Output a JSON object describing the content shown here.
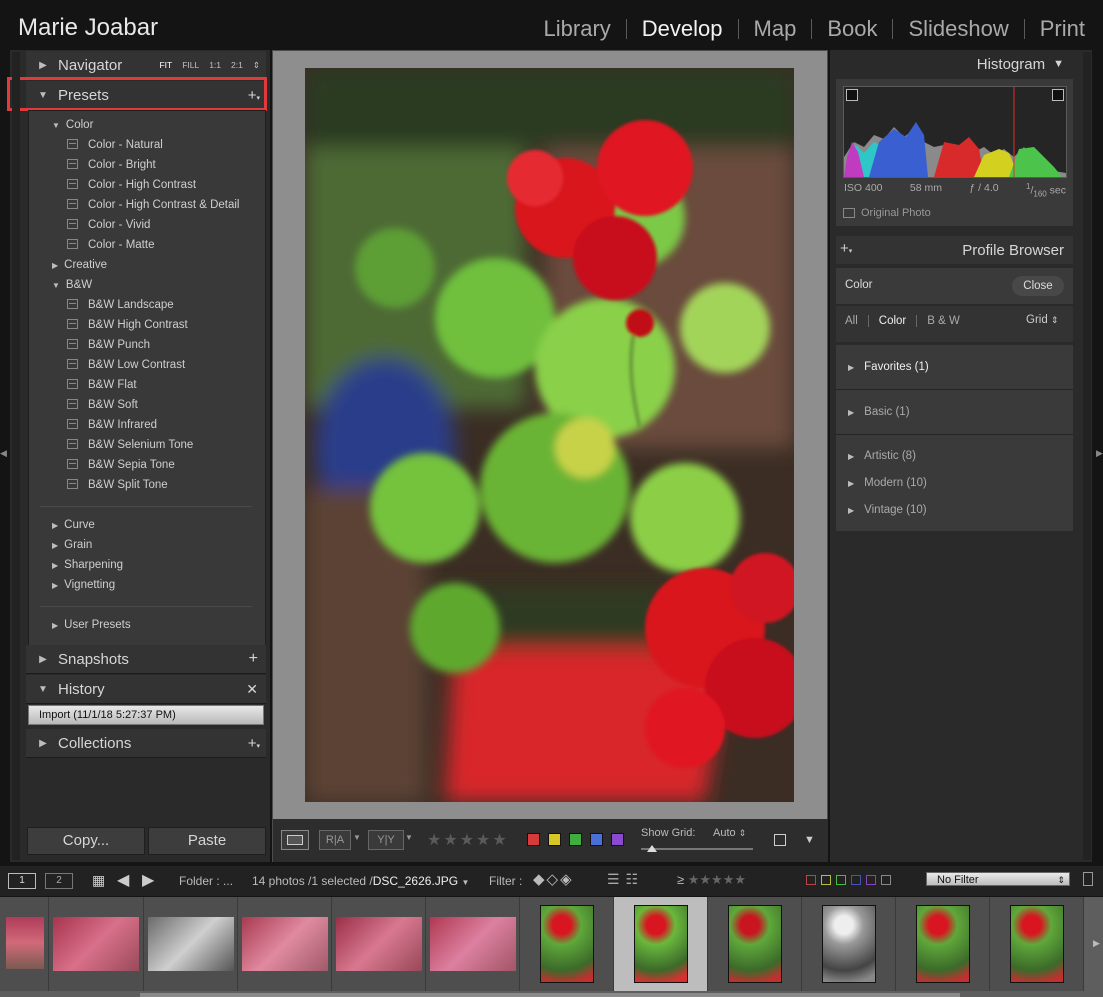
{
  "identity": "Marie Joabar",
  "modules": [
    "Library",
    "Develop",
    "Map",
    "Book",
    "Slideshow",
    "Print"
  ],
  "active_module": "Develop",
  "left": {
    "navigator": {
      "label": "Navigator",
      "zoom_options": [
        "FIT",
        "FILL",
        "1:1",
        "2:1"
      ]
    },
    "presets": {
      "label": "Presets",
      "color_folder": "Color",
      "color_items": [
        "Color - Natural",
        "Color - Bright",
        "Color - High Contrast",
        "Color - High Contrast & Detail",
        "Color - Vivid",
        "Color - Matte"
      ],
      "creative_folder": "Creative",
      "bw_folder": "B&W",
      "bw_items": [
        "B&W Landscape",
        "B&W High Contrast",
        "B&W Punch",
        "B&W Low Contrast",
        "B&W Flat",
        "B&W Soft",
        "B&W Infrared",
        "B&W Selenium Tone",
        "B&W Sepia Tone",
        "B&W Split Tone"
      ],
      "other_folders": [
        "Curve",
        "Grain",
        "Sharpening",
        "Vignetting"
      ],
      "user_folder": "User Presets"
    },
    "snapshots": {
      "label": "Snapshots"
    },
    "history": {
      "label": "History",
      "entry": "Import (11/1/18 5:27:37 PM)"
    },
    "collections": {
      "label": "Collections"
    },
    "copy_label": "Copy...",
    "paste_label": "Paste"
  },
  "right": {
    "histogram": {
      "label": "Histogram",
      "iso": "ISO 400",
      "focal": "58 mm",
      "aperture": "ƒ / 4.0",
      "shutter_num": "1",
      "shutter_den": "160",
      "shutter_unit": "sec",
      "original_photo": "Original Photo"
    },
    "profile_browser": {
      "label": "Profile Browser",
      "current": "Color",
      "close_label": "Close",
      "filters": [
        "All",
        "Color",
        "B & W"
      ],
      "active_filter": "Color",
      "view": "Grid",
      "groups": [
        {
          "label": "Favorites (1)"
        },
        {
          "label": "Basic (1)"
        },
        {
          "label": "Artistic (8)"
        },
        {
          "label": "Modern (10)"
        },
        {
          "label": "Vintage (10)"
        }
      ]
    }
  },
  "toolbar": {
    "show_grid_label": "Show Grid:",
    "show_grid_value": "Auto",
    "ra_label": "R|A",
    "yy_label": "Y|Y",
    "swatches": [
      "#d83a3a",
      "#d6c626",
      "#3fae3f",
      "#4a6fd8",
      "#8a4ad0"
    ]
  },
  "filmbar": {
    "view1": "1",
    "view2": "2",
    "folder_label": "Folder :",
    "folder_name": "...",
    "count_text": "14 photos /1 selected /",
    "filename": "DSC_2626.JPG",
    "filter_label": "Filter :",
    "no_filter": "No Filter",
    "rating_op": "≥"
  },
  "icons": {
    "navigator_tri": "triangle-right-icon",
    "presets_tri": "triangle-down-icon"
  }
}
